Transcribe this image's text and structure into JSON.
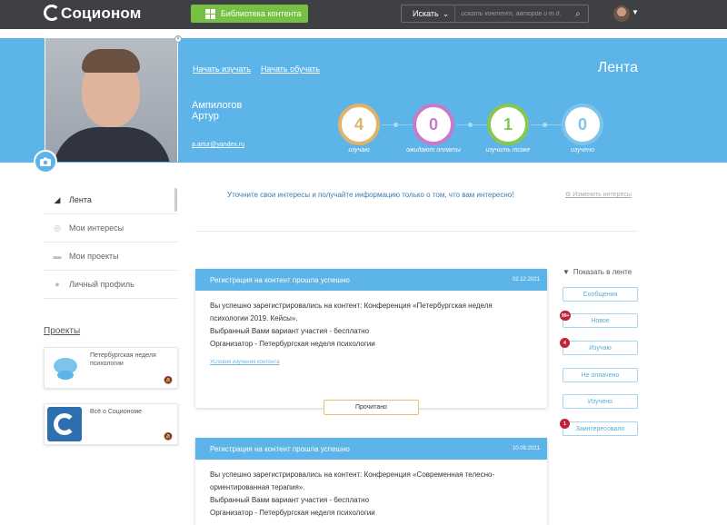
{
  "topbar": {
    "logo": "Соционом",
    "library_button": "Библиотека контента",
    "search_select": "Искать",
    "search_placeholder": "искать контент, авторов и т.д."
  },
  "header": {
    "link_learn": "Начать изучать",
    "link_teach": "Начать обучать",
    "feed_title": "Лента",
    "last_name": "Ампилогов",
    "first_name": "Артур",
    "email": "a.artur@yandex.ru",
    "stats": [
      {
        "value": "4",
        "label": "изучаю",
        "color": "#e0b36d"
      },
      {
        "value": "0",
        "label": "ожидают оплаты",
        "color": "#c77ac8"
      },
      {
        "value": "1",
        "label": "изучить позже",
        "color": "#86c84e"
      },
      {
        "value": "0",
        "label": "изучено",
        "color": "#7ec3ea"
      }
    ]
  },
  "sidebar": {
    "items": [
      {
        "label": "Лента"
      },
      {
        "label": "Мои интересы"
      },
      {
        "label": "Мои проекты"
      },
      {
        "label": "Личный профиль"
      }
    ],
    "projects_title": "Проекты",
    "projects": [
      {
        "name": "Петербургская неделя психологии"
      },
      {
        "name": "Всё о Социономе"
      }
    ]
  },
  "main": {
    "interests_prompt": "Уточните свои интересы и получайте информацию только о том, что вам интересно!",
    "change_interests": "Изменить интересы",
    "feed": [
      {
        "title": "Регистрация на контент прошла успешно",
        "date": "02.12.2021",
        "lines": [
          "Вы успешно зарегистрировались на контент: Конференция «Петербургская неделя",
          "психологии 2019. Кейсы».",
          "Выбранный Вами вариант участия - бесплатно",
          "Организатор - Петербургская неделя психологии"
        ],
        "link": "Условия изучения контента",
        "action": "Прочитано"
      },
      {
        "title": "Регистрация на контент прошла успешно",
        "date": "10.09.2021",
        "lines": [
          "Вы успешно зарегистрировались на контент: Конференция «Современная телесно-",
          "ориентированная терапия».",
          "Выбранный Вами вариант участия - бесплатно",
          "Организатор - Петербургская неделя психологии"
        ]
      }
    ]
  },
  "filters": {
    "title": "Показать в ленте",
    "items": [
      {
        "label": "Сообщения",
        "badge": ""
      },
      {
        "label": "Новое",
        "badge": "99+"
      },
      {
        "label": "Изучаю",
        "badge": "4"
      },
      {
        "label": "Не оплачено",
        "badge": ""
      },
      {
        "label": "Изучено",
        "badge": ""
      },
      {
        "label": "Заинтересовало",
        "badge": "1"
      }
    ]
  }
}
